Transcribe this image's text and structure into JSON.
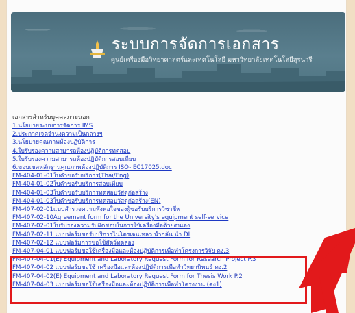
{
  "header": {
    "title": "ระบบการจัดการเอกสาร",
    "subtitle": "ศูนย์เครื่องมือวิทยาศาสตร์และเทคโนโลยี มหาวิทยาลัยเทคโนโลยีสุรนารี"
  },
  "section": {
    "heading": "เอกสารสำหรับบุคคลภายนอก"
  },
  "documents": [
    "1.นโยบายระบบการจัดการ IMS",
    "2.ประกาศเจตจำนงความเป็นกลางฯ",
    "3.นโยบายคุณภาพห้องปฏิบัติการ",
    "4.ใบรับรองความสามารถห้องปฏิบัติการทดสอบ",
    "5.ใบรับรองความสามารถห้องปฏิบัติการสอบเทียบ",
    "6.ขอบเขตหลักฐานคุณภาพห้องปฏิบัติการ ISO-IEC17025.doc",
    "FM-404-01-01ใบคำขอรับบริการ(Thai/Eng)",
    "FM-404-01-02ใบคำขอรับบริการสอบเทียบ",
    "FM-404-01-03ใบคำขอรับบริการทดสอบวัสดุก่อสร้าง",
    "FM-404-01-03ใบคำขอรับบริการทดสอบวัสดุก่อสร้าง(EN)",
    "FM-407-02-01แบบสำรวจความพึงพอใจของผู้ขอรับบริการวิชาชีพ",
    "FM-407-02-10Agreement form for the University's equipment self-service",
    "FM-407-02-01ใบรับรองความรับผิดชอบในการใช้เครื่องมือด้วยตนเอง",
    "FM-407-02-11 แบบฟอร์มขอรับบริการไนโตรเจนเหลว น้ำกลั่น น้ำ DI",
    "FM-407-02-12 แบบฟอร์มการขอใช้สัตว์ทดลอง",
    "FM-407-04-01 แบบฟอร์มขอใช้เครื่องมือและห้องปฏิบัติการเพื่อทำโครงการวิจัย คง.3",
    "FM-407-04-01(E) Equipment and Laboratory Request Form for Research Project P.3",
    "FM-407-04-02 แบบฟอร์มขอใช้ เครื่องมือและห้องปฏิบัติการเพื่อทำวิทยานิพนธ์ คง.2",
    "FM-407-04-02(E) Equipment and Laboratory Request Form for Thesis Work P.2",
    "FM-407-04-03 แบบฟอร์มขอใช้เครื่องมือและห้องปฏิบัติการเพื่อทำโครงงาน (คง1)"
  ],
  "colors": {
    "highlight": "#e2191b",
    "link": "#1d39c4",
    "banner": "#4f7482",
    "background": "#f1dfc4"
  }
}
